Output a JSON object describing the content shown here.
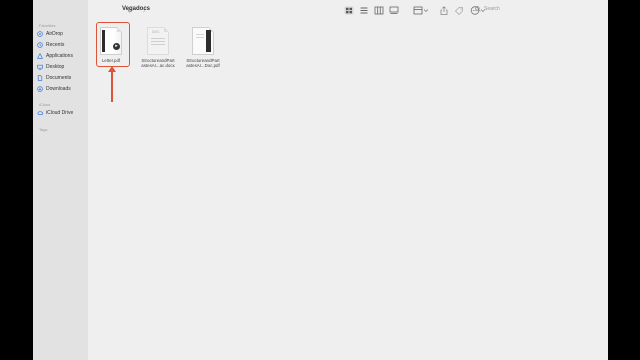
{
  "title": "Vegadocs",
  "sidebar": {
    "favorites_label": "Favorites",
    "items": [
      {
        "label": "AirDrop",
        "icon": "airdrop-icon"
      },
      {
        "label": "Recents",
        "icon": "recents-icon"
      },
      {
        "label": "Applications",
        "icon": "applications-icon"
      },
      {
        "label": "Desktop",
        "icon": "desktop-icon"
      },
      {
        "label": "Documents",
        "icon": "documents-icon"
      },
      {
        "label": "Downloads",
        "icon": "downloads-icon"
      }
    ],
    "icloud_label": "iCloud",
    "icloud_items": [
      {
        "label": "iCloud Drive",
        "icon": "icloud-icon"
      }
    ],
    "tags_label": "Tags"
  },
  "toolbar": {
    "search_label": "Search"
  },
  "files": [
    {
      "name": "Letter.pdf",
      "selected": true
    },
    {
      "name": "StructureandPart\nastesAr...ac.docx",
      "badge": "DOC"
    },
    {
      "name": "StructureandPart\nastesAr...Doc.pdf"
    }
  ],
  "colors": {
    "highlight": "#e0533b"
  }
}
